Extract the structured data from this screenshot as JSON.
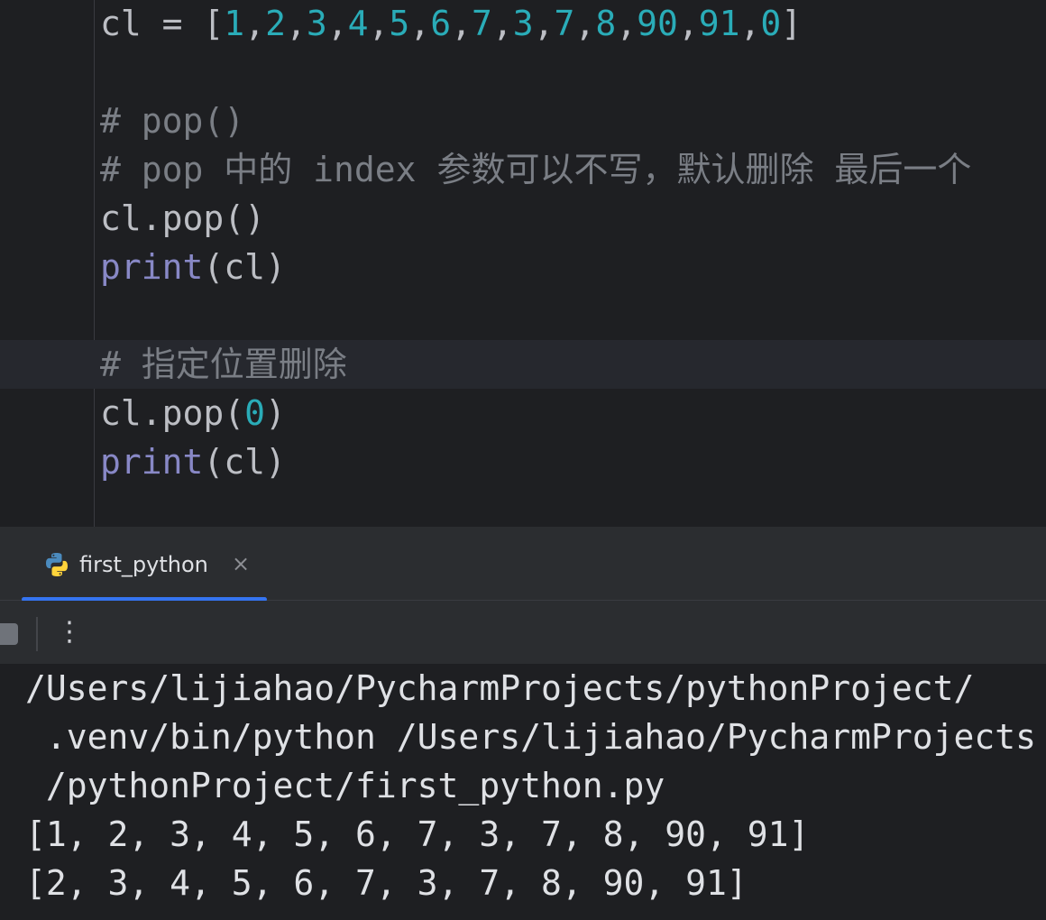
{
  "editor": {
    "lines": [
      {
        "segments": [
          {
            "text": "cl = [",
            "cls": ""
          },
          {
            "text": "1",
            "cls": "tok-num"
          },
          {
            "text": ",",
            "cls": ""
          },
          {
            "text": "2",
            "cls": "tok-num"
          },
          {
            "text": ",",
            "cls": ""
          },
          {
            "text": "3",
            "cls": "tok-num"
          },
          {
            "text": ",",
            "cls": ""
          },
          {
            "text": "4",
            "cls": "tok-num"
          },
          {
            "text": ",",
            "cls": ""
          },
          {
            "text": "5",
            "cls": "tok-num"
          },
          {
            "text": ",",
            "cls": ""
          },
          {
            "text": "6",
            "cls": "tok-num"
          },
          {
            "text": ",",
            "cls": ""
          },
          {
            "text": "7",
            "cls": "tok-num"
          },
          {
            "text": ",",
            "cls": ""
          },
          {
            "text": "3",
            "cls": "tok-num"
          },
          {
            "text": ",",
            "cls": ""
          },
          {
            "text": "7",
            "cls": "tok-num"
          },
          {
            "text": ",",
            "cls": ""
          },
          {
            "text": "8",
            "cls": "tok-num"
          },
          {
            "text": ",",
            "cls": ""
          },
          {
            "text": "90",
            "cls": "tok-num"
          },
          {
            "text": ",",
            "cls": ""
          },
          {
            "text": "91",
            "cls": "tok-num"
          },
          {
            "text": ",",
            "cls": ""
          },
          {
            "text": "0",
            "cls": "tok-num"
          },
          {
            "text": "]",
            "cls": ""
          }
        ]
      },
      {
        "segments": []
      },
      {
        "segments": [
          {
            "text": "# pop()",
            "cls": "tok-cm"
          }
        ]
      },
      {
        "segments": [
          {
            "text": "# pop ",
            "cls": "tok-cm"
          },
          {
            "text": "中的",
            "cls": "tok-cm tok-cjk"
          },
          {
            "text": " index ",
            "cls": "tok-cm"
          },
          {
            "text": "参数可以不写，默认删除",
            "cls": "tok-cm tok-cjk"
          },
          {
            "text": " ",
            "cls": "tok-cm"
          },
          {
            "text": "最后一个",
            "cls": "tok-cm tok-cjk"
          }
        ]
      },
      {
        "segments": [
          {
            "text": "cl.pop()",
            "cls": ""
          }
        ]
      },
      {
        "segments": [
          {
            "text": "print",
            "cls": "tok-kw"
          },
          {
            "text": "(cl)",
            "cls": ""
          }
        ]
      },
      {
        "segments": []
      },
      {
        "segments": [
          {
            "text": "# ",
            "cls": "tok-cm"
          },
          {
            "text": "指定位置删除",
            "cls": "tok-cm tok-cjk"
          }
        ],
        "current": true
      },
      {
        "segments": [
          {
            "text": "cl.pop(",
            "cls": ""
          },
          {
            "text": "0",
            "cls": "tok-num"
          },
          {
            "text": ")",
            "cls": ""
          }
        ]
      },
      {
        "segments": [
          {
            "text": "print",
            "cls": "tok-kw"
          },
          {
            "text": "(cl)",
            "cls": ""
          }
        ]
      }
    ]
  },
  "run_panel": {
    "tab_label": "first_python",
    "tab_icon": "python-icon",
    "close_icon": "close-icon",
    "toolbar_icons": [
      "stop-icon",
      "more-vertical-icon"
    ]
  },
  "console": {
    "lines": [
      "/Users/lijiahao/PycharmProjects/pythonProject/",
      " .venv/bin/python /Users/lijiahao/PycharmProjects",
      " /pythonProject/first_python.py",
      "[1, 2, 3, 4, 5, 6, 7, 3, 7, 8, 90, 91]",
      "[2, 3, 4, 5, 6, 7, 3, 7, 8, 90, 91]"
    ]
  },
  "colors": {
    "background": "#1e1f22",
    "panel": "#2b2d30",
    "number": "#2aacb8",
    "builtin": "#8888c6",
    "comment": "#7a7e85",
    "accent": "#3574f0"
  }
}
